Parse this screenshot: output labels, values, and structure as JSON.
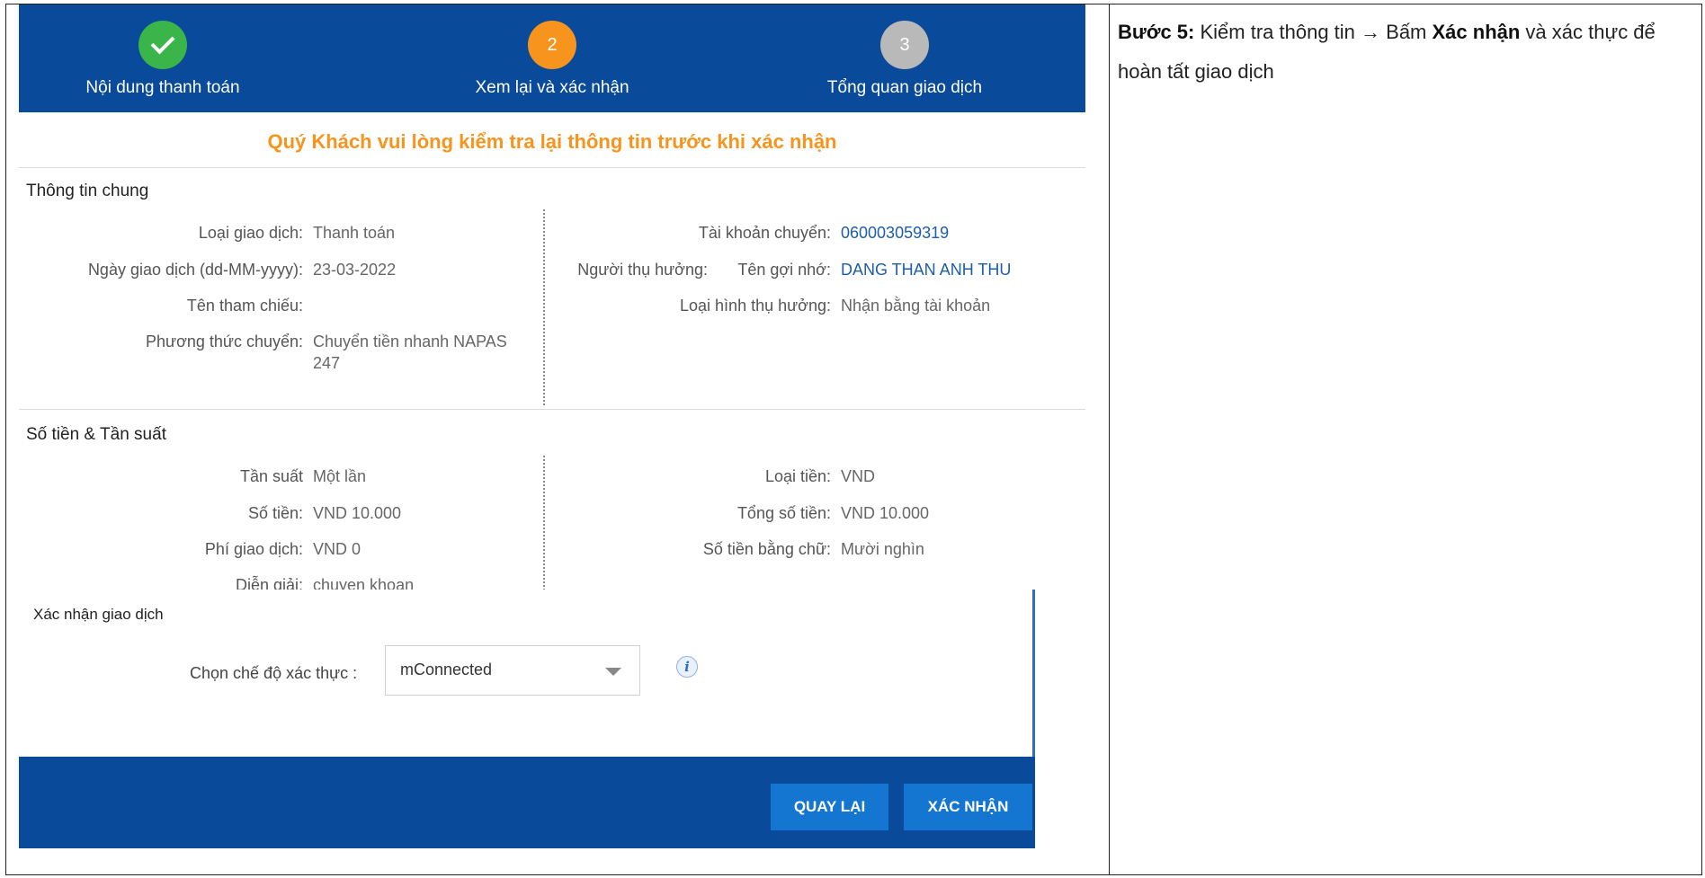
{
  "steps": [
    {
      "number": "",
      "label": "Nội dung thanh toán",
      "state": "done"
    },
    {
      "number": "2",
      "label": "Xem lại và xác nhận",
      "state": "active"
    },
    {
      "number": "3",
      "label": "Tổng quan giao dịch",
      "state": "todo"
    }
  ],
  "notice": "Quý Khách vui lòng kiểm tra lại thông tin trước khi xác nhận",
  "general": {
    "title": "Thông tin chung",
    "left": [
      {
        "label": "Loại giao dịch:",
        "value": "Thanh toán"
      },
      {
        "label": "Ngày giao dịch (dd-MM-yyyy):",
        "value": "23-03-2022"
      },
      {
        "label": "Tên tham chiếu:",
        "value": ""
      },
      {
        "label": "Phương thức chuyển:",
        "value_line1": "Chuyển tiền nhanh NAPAS",
        "value_line2": "247"
      }
    ],
    "right": [
      {
        "label": "Tài khoản chuyển:",
        "value": "060003059319"
      },
      {
        "label": "Người thụ hưởng:",
        "sublabel": "Tên gợi nhớ:",
        "value": "DANG THAN ANH THU"
      },
      {
        "label": "Loại hình thụ hưởng:",
        "value": "Nhận bằng tài khoản"
      }
    ]
  },
  "amount": {
    "title": "Số tiền & Tần suất",
    "left": [
      {
        "label": "Tần suất",
        "value": "Một lần"
      },
      {
        "label": "Số tiền:",
        "value": "VND 10.000"
      },
      {
        "label": "Phí giao dịch:",
        "value": "VND 0"
      },
      {
        "label": "Diễn giải:",
        "value": "chuyen khoan"
      }
    ],
    "right": [
      {
        "label": "Loại tiền:",
        "value": "VND"
      },
      {
        "label": "Tổng số tiền:",
        "value": "VND 10.000"
      },
      {
        "label": "Số tiền bằng chữ:",
        "value": "Mười nghìn"
      }
    ]
  },
  "confirm": {
    "title": "Xác nhận giao dịch",
    "auth_label": "Chọn chế độ xác thực   :",
    "auth_value": "mConnected",
    "back_label": "QUAY LẠI",
    "confirm_label": "XÁC NHẬN"
  },
  "instruction": {
    "step": "Bước 5:",
    "text1": " Kiểm tra thông tin ",
    "arrow": "→",
    "text2": " Bấm ",
    "action": "Xác nhận",
    "text3": " và xác thực để hoàn tất giao dịch"
  },
  "colors": {
    "header": "#0a4a9a",
    "accent": "#f7941d",
    "done": "#39b54a",
    "button": "#1476d1"
  },
  "icons": {
    "done": "check-icon",
    "info": "info-icon",
    "dropdown": "chevron-down-icon"
  }
}
